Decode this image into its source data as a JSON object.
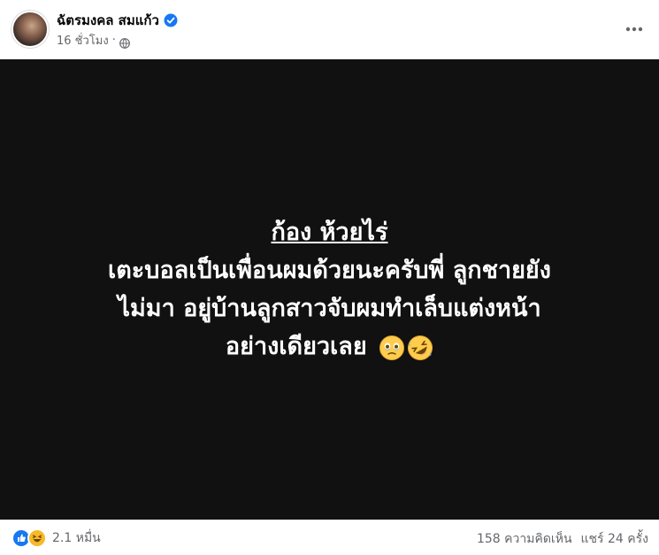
{
  "post": {
    "author": "ฉัตรมงคล สมแก้ว",
    "time": "16 ชั่วโมง",
    "privacy_icon": "globe-icon",
    "more_icon": "more-horizontal-icon"
  },
  "content": {
    "headline": "ก้อง ห้วยไร่",
    "lines": [
      "เตะบอลเป็นเพื่อนผมด้วยนะครับพี่ ลูกชายยัง",
      "ไม่มา อยู่บ้านลูกสาวจับผมทำเล็บแต่งหน้า",
      "อย่างเดียวเลย"
    ],
    "emojis": [
      "face-holding-back-tears-emoji",
      "rolling-on-floor-laughing-emoji"
    ],
    "background": "#111111"
  },
  "footer": {
    "reaction_icons": [
      "like-icon",
      "haha-icon"
    ],
    "reaction_count": "2.1 หมื่น",
    "comments": "158 ความคิดเห็น",
    "shares": "แชร์ 24 ครั้ง"
  },
  "colors": {
    "accent": "#1877f2",
    "text_secondary": "#65676b"
  }
}
